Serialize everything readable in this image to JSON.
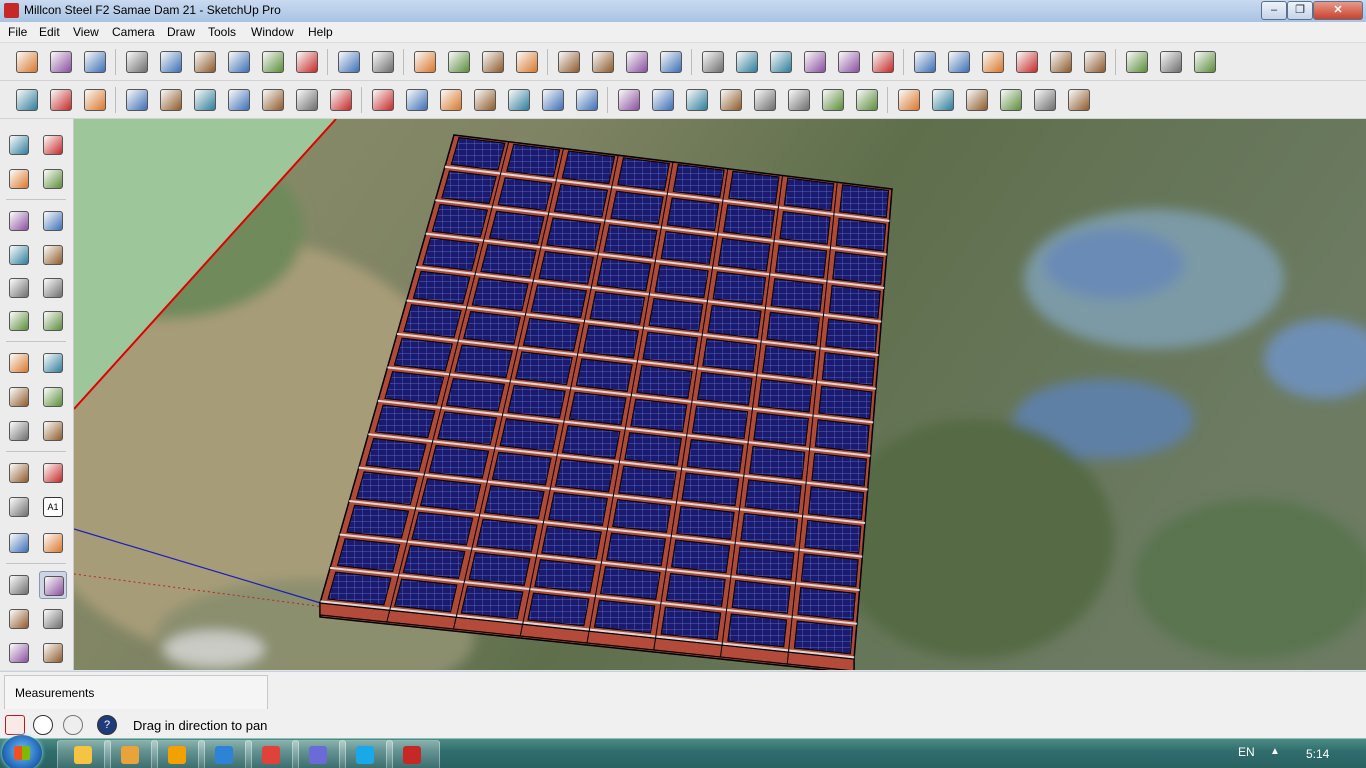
{
  "window": {
    "title": "Millcon Steel F2 Samae Dam 21 - SketchUp Pro",
    "minimize": "–",
    "maximize": "❐",
    "close": "✕"
  },
  "menu": [
    "File",
    "Edit",
    "View",
    "Camera",
    "Draw",
    "Tools",
    "Window",
    "Help"
  ],
  "toolbar1": {
    "groups": [
      [
        "new-file-icon",
        "open-file-icon",
        "save-icon"
      ],
      [
        "cut-icon",
        "copy-icon",
        "paste-icon",
        "erase-selection-icon",
        "undo-icon",
        "redo-icon"
      ],
      [
        "print-icon",
        "model-info-icon"
      ],
      [
        "add-location-icon",
        "toggle-terrain-icon",
        "photo-textures-icon",
        "geo-location-icon"
      ],
      [
        "warehouse-icon",
        "share-model-icon",
        "share-component-icon",
        "extension-warehouse-icon"
      ],
      [
        "xray-icon",
        "back-edges-icon",
        "wireframe-icon",
        "hidden-line-icon",
        "shaded-icon",
        "shaded-textures-icon"
      ],
      [
        "iso-view-icon",
        "top-view-icon",
        "front-view-icon",
        "right-view-icon",
        "back-view-icon",
        "left-view-icon"
      ],
      [
        "section-plane-icon",
        "display-section-planes-icon",
        "display-section-cuts-icon"
      ]
    ]
  },
  "toolbar2": {
    "groups": [
      [
        "select-hand-icon",
        "make-component-icon",
        "paint-bucket-icon"
      ],
      [
        "top-face-icon",
        "section-box-icon",
        "outline-box-icon",
        "face-icon",
        "shaded-face-icon",
        "dark-style-icon",
        "blue-style-icon"
      ],
      [
        "sandbox-from-contours-icon",
        "sandbox-from-scratch-icon",
        "smoove-icon",
        "stamp-icon",
        "drape-icon",
        "add-detail-icon",
        "flip-edge-icon"
      ],
      [
        "rectangle-icon",
        "pencil-icon",
        "circle-icon",
        "freehand-icon",
        "polygon-icon",
        "arc-icon",
        "pie-icon",
        "two-point-arc-icon"
      ],
      [
        "move-icon",
        "push-pull-icon",
        "rotate-icon",
        "follow-me-icon",
        "scale-icon",
        "offset-icon"
      ]
    ]
  },
  "left_tools": [
    [
      "select-arrow-icon",
      "make-component-icon"
    ],
    [
      "paint-bucket-icon",
      "eraser-icon"
    ],
    [
      "rectangle-icon",
      "pencil-icon"
    ],
    [
      "circle-icon",
      "freehand-icon"
    ],
    [
      "polygon-icon",
      "arc-icon"
    ],
    [
      "pie-icon",
      "two-point-arc-icon"
    ],
    [
      "move-icon",
      "push-pull-icon"
    ],
    [
      "rotate-icon",
      "follow-me-icon"
    ],
    [
      "scale-icon",
      "offset-icon"
    ],
    [
      "tape-measure-icon",
      "dimension-icon"
    ],
    [
      "protractor-icon",
      "text-icon"
    ],
    [
      "axes-icon",
      "3d-text-icon"
    ],
    [
      "orbit-icon",
      "pan-hand-icon"
    ],
    [
      "zoom-icon",
      "zoom-window-icon"
    ],
    [
      "zoom-extents-icon",
      "previous-view-icon"
    ]
  ],
  "active_tool": "pan-hand-icon",
  "left_tool_text": "A1",
  "measurements": {
    "label": "Measurements",
    "value": ""
  },
  "status": {
    "text": "Drag in direction to pan",
    "icons": [
      "geo-location-status-icon",
      "credits-icon",
      "user-account-icon",
      "help-icon"
    ],
    "help_glyph": "?"
  },
  "taskbar": {
    "apps": [
      "file-explorer-icon",
      "media-player-icon",
      "outlook-icon",
      "internet-explorer-icon",
      "chrome-icon",
      "picasa-icon",
      "skype-icon",
      "sketchup-icon"
    ],
    "language": "EN",
    "tray_arrow": "▲",
    "clock": "5:14"
  },
  "colors": {
    "panel_frame": "#b04a38",
    "panel_cell": "#1a1a6e",
    "cell_grid": "#6a7bd6",
    "green_plane": "#9dc79a",
    "red_axis": "#e00000",
    "blue_axis": "#1d1dba"
  },
  "scene": {
    "array_rows": 14,
    "array_cols": 8
  }
}
